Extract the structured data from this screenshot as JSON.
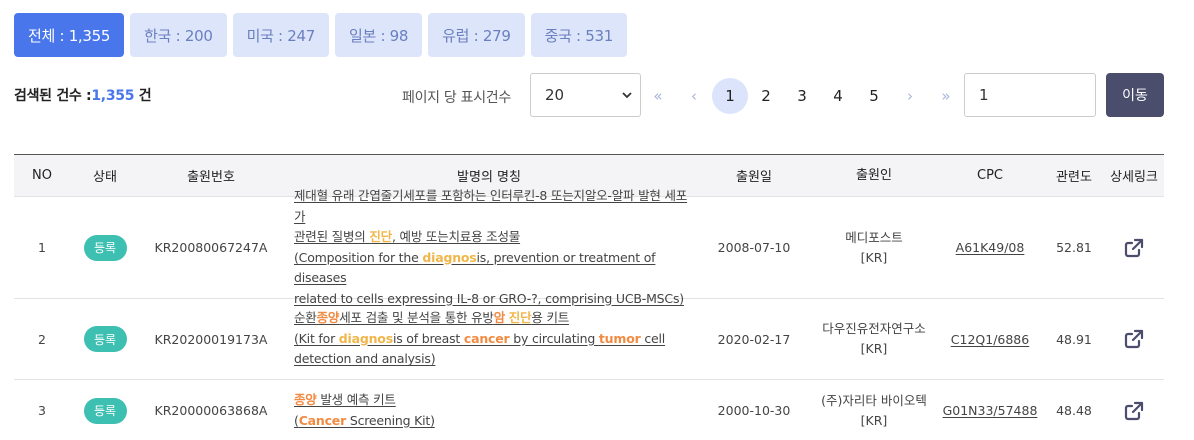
{
  "tabs": [
    {
      "label": "전체 : 1,355"
    },
    {
      "label": "한국 : 200"
    },
    {
      "label": "미국 : 247"
    },
    {
      "label": "일본 : 98"
    },
    {
      "label": "유럽 : 279"
    },
    {
      "label": "중국 : 531"
    }
  ],
  "result": {
    "prefix": "검색된 건수 :",
    "count": "1,355",
    "suffix": " 건"
  },
  "per_page": {
    "label": "페이지 당 표시건수",
    "value": "20"
  },
  "pager": {
    "first": "«",
    "prev": "‹",
    "pages": [
      "1",
      "2",
      "3",
      "4",
      "5"
    ],
    "next": "›",
    "last": "»",
    "current": "1"
  },
  "goto": {
    "value": "1",
    "button": "이동"
  },
  "table": {
    "headers": {
      "no": "NO",
      "status": "상태",
      "appno": "출원번호",
      "title": "발명의 명칭",
      "date": "출원일",
      "applicant": "출원인",
      "cpc": "CPC",
      "rel": "관련도",
      "link": "상세링크"
    },
    "rows": [
      {
        "no": "1",
        "status": "등록",
        "appno": "KR20080067247A",
        "t1": "제대혈 유래 간엽줄기세포를 포함하는 인터루킨-8 또는지알오-알파 발현 세포가",
        "t2a": "관련된 질병의 ",
        "t2hl": "진단",
        "t2b": ", 예방 또는치료용 조성물",
        "t3a": "(Composition for the ",
        "t3hl": "diagnos",
        "t3b": "is, prevention or treatment of diseases",
        "t4": "related to cells expressing IL-8 or GRO-?, comprising UCB-MSCs)",
        "date": "2008-07-10",
        "applicant": "메디포스트",
        "country": "[KR]",
        "cpc": "A61K49/08",
        "rel": "52.81"
      },
      {
        "no": "2",
        "status": "등록",
        "appno": "KR20200019173A",
        "t1a": "순환",
        "t1hl1": "종양",
        "t1b": "세포 검출 및 분석을 통한 유방",
        "t1hl2": "암",
        "t1c": " ",
        "t1hl3": "진단",
        "t1d": "용 키트",
        "t2a": "(Kit for ",
        "t2hl1": "diagnos",
        "t2b": "is of breast ",
        "t2hl2": "cancer",
        "t2c": " by circulating ",
        "t2hl3": "tumor",
        "t2d": " cell",
        "t3": "detection and analysis)",
        "date": "2020-02-17",
        "applicant": "다우진유전자연구소",
        "country": "[KR]",
        "cpc": "C12Q1/6886",
        "rel": "48.91"
      },
      {
        "no": "3",
        "status": "등록",
        "appno": "KR20000063868A",
        "t1hl": "종양",
        "t1b": " 발생 예측 키트",
        "t2a": "(",
        "t2hl": "Cancer",
        "t2b": " Screening Kit)",
        "date": "2000-10-30",
        "applicant": "(주)자리타 바이오텍",
        "country": "[KR]",
        "cpc": "G01N33/57488",
        "rel": "48.48"
      }
    ]
  },
  "icons": {
    "external": "external-link-icon",
    "select": "chevron-down-icon"
  },
  "colors": {
    "accent": "#4a76ec",
    "tab_inactive": "#dde5fb",
    "badge": "#3dbfb1",
    "highlight_yellow": "#f0b64a",
    "highlight_orange": "#f28b42",
    "go_button": "#4a4e6c"
  }
}
